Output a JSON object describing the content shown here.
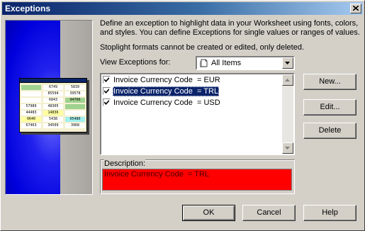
{
  "window": {
    "title": "Exceptions"
  },
  "instructions": "Define an exception to highlight data in your Worksheet using fonts, colors,\nand styles. You can define Exceptions for single values or ranges of values.",
  "stoplight_note": "Stoplight formats cannot be created or edited, only deleted.",
  "view_filter": {
    "label": "View Exceptions for:",
    "selected": "All Items"
  },
  "exceptions": [
    {
      "label": "Invoice Currency Code  = EUR",
      "checked": true,
      "selected": false
    },
    {
      "label": "Invoice Currency Code  = TRL",
      "checked": true,
      "selected": true
    },
    {
      "label": "Invoice Currency Code  = USD",
      "checked": true,
      "selected": false
    }
  ],
  "side_buttons": {
    "new": "New...",
    "edit": "Edit...",
    "delete": "Delete"
  },
  "description": {
    "label": "Description:",
    "text": "Invoice Currency Code  = TRL",
    "background_color": "#ff0000"
  },
  "footer_buttons": {
    "ok": "OK",
    "cancel": "Cancel",
    "help": "Help"
  },
  "preview_sheet": {
    "cells": [
      "",
      "6749",
      "5839",
      "",
      "85594",
      "39578",
      "",
      "6843",
      "94766",
      "57989",
      "48305",
      "",
      "44483",
      "14836",
      "",
      "0640",
      "5438",
      "05480",
      "67463",
      "34509",
      "3968"
    ]
  },
  "colors": {
    "selection": "#0a246a",
    "dialog_face": "#d4d0c8",
    "title_start": "#0a246a",
    "title_end": "#a6caf0"
  }
}
